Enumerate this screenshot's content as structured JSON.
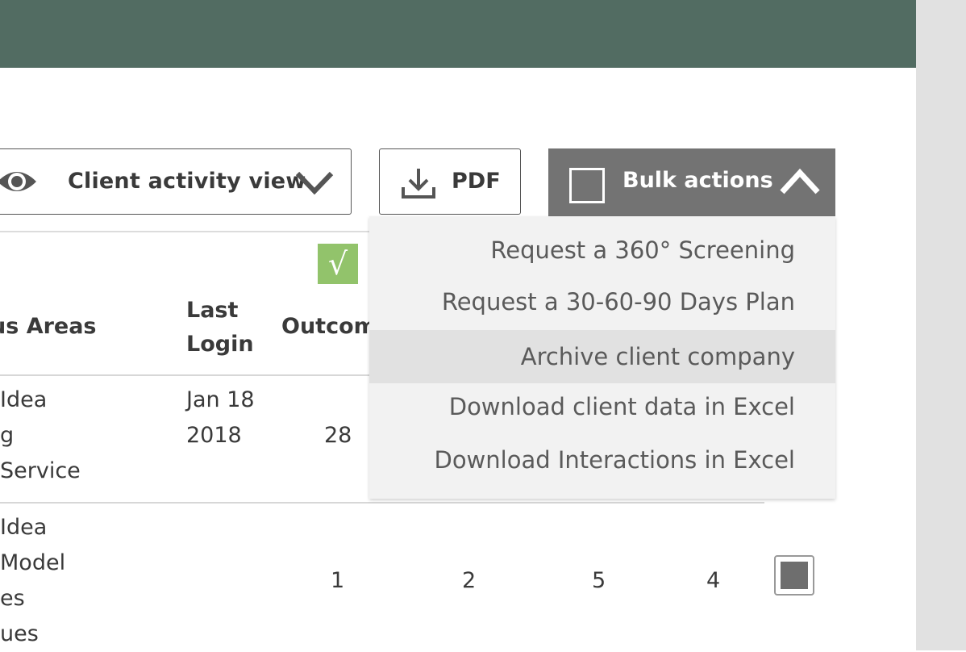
{
  "toolbar": {
    "view_select_label": "Client activity view",
    "pdf_label": "PDF",
    "bulk_actions_label": "Bulk actions"
  },
  "bulk_menu": {
    "items": [
      "Request a 360° Screening",
      "Request a 30-60-90 Days Plan",
      "Archive client company",
      "Download client data in Excel",
      "Download Interactions in Excel"
    ],
    "highlighted_index": 2
  },
  "table": {
    "headers": {
      "focus_areas": "us Areas",
      "last_login_line1": "Last",
      "last_login_line2": "Login",
      "outcomes": "Outcom"
    },
    "rows": [
      {
        "focus_lines": [
          "Idea",
          "g",
          "Service"
        ],
        "last_login_line1": "Jan 18",
        "last_login_line2": "2018",
        "outcomes": "28"
      },
      {
        "focus_lines": [
          "Idea",
          "Model",
          "es",
          "ues"
        ],
        "outcomes": "1",
        "col2": "2",
        "col3": "5",
        "col4": "4"
      }
    ]
  },
  "colors": {
    "header": "#526c62",
    "bulk_button": "#737373",
    "check_green": "#92c36b",
    "menu_bg": "#f2f2f2",
    "menu_hover": "#e1e1e1"
  },
  "icons": {
    "eye": "eye-icon",
    "chevron": "chevron-down-icon",
    "download": "download-icon",
    "chevron_up": "chevron-up-icon",
    "check": "checkmark-icon"
  },
  "check_symbol": "√"
}
